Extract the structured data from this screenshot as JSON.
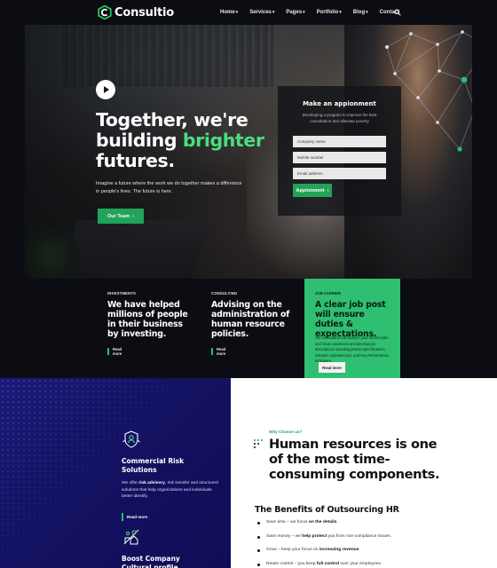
{
  "brand": {
    "name": "Consultio",
    "accent": "#22a35a",
    "accent_light": "#4ade80",
    "mark_icon": "consultio-c-logo"
  },
  "nav": {
    "items": [
      {
        "label": "Home",
        "has_caret": true
      },
      {
        "label": "Services",
        "has_caret": true
      },
      {
        "label": "Pages",
        "has_caret": true
      },
      {
        "label": "Portfolio",
        "has_caret": true
      },
      {
        "label": "Blog",
        "has_caret": true
      },
      {
        "label": "Contact",
        "has_caret": false
      }
    ],
    "search_icon": "search-icon"
  },
  "hero": {
    "title_line1": "Together, we're",
    "title_line2_pre": "building ",
    "title_line2_accent": "brighter",
    "title_line3": "futures.",
    "paragraph": "Imagine a future where the work we do together makes a difference in people's lives. The future is here.",
    "button": "Our Team",
    "button_arrow": "›",
    "play_icon": "play-icon"
  },
  "appointment": {
    "title": "Make an appionment",
    "subtitle": "Developing a program to improve the best consultation and alleviate poverty",
    "fields": [
      "Company name",
      "Mobile number",
      "Email address"
    ],
    "button": "Appionment",
    "button_arrow": "›"
  },
  "cards": [
    {
      "category": "INVESTMENTS",
      "title": "We have helped millions of people in their business by investing.",
      "read_more": "Read more"
    },
    {
      "category": "CONSULTING",
      "title": "Advising on the administration of human resource policies.",
      "read_more": "Read more"
    }
  ],
  "featured_card": {
    "category": "JOB CARRIER",
    "title": "A clear job post will ensure duties & expectations.",
    "description": "Our consultants will analyze your current jobs and future vacancies and develop job descriptions including person specifications, relevant competencies, and Key Performance Indicators.",
    "button": "Read more"
  },
  "services": [
    {
      "icon": "shield-risk-icon",
      "title": "Commercial Risk Solutions",
      "desc_pre": "We offer ",
      "desc_bold": "risk advisory",
      "desc_post": ", risk transfer and structured solutions that help organizations and individuals better identify.",
      "read_more": "Read more"
    },
    {
      "icon": "team-culture-icon",
      "title": "Boost Company Cultural profile"
    }
  ],
  "why": {
    "eyebrow": "Why Choose us?",
    "title": "Human resources is one of the most time-consuming components.",
    "benefits_title": "The Benefits of Outsourcing HR",
    "benefits": [
      {
        "pre": "Save time – we focus ",
        "bold": "on the details",
        "post": "."
      },
      {
        "pre": "Save money – we ",
        "bold": "help protect",
        "post": " you from non-compliance issues."
      },
      {
        "pre": "Grow – keep your focus on ",
        "bold": "increasing revenue",
        "post": "."
      },
      {
        "pre": "Retain control – you keep ",
        "bold": "full control",
        "post": " over your employees."
      }
    ]
  }
}
